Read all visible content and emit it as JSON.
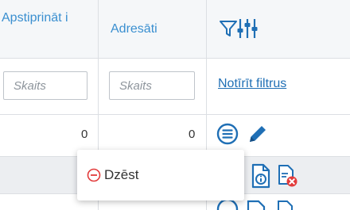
{
  "columns": {
    "apstiprinati_title": "Apstiprināt i",
    "adresati_title": "Adresāti"
  },
  "filters": {
    "apstiprinati_placeholder": "Skaits",
    "adresati_placeholder": "Skaits",
    "clear_label": "Notīrīt filtrus"
  },
  "row1": {
    "apstiprinati_value": "0",
    "adresati_value": "0"
  },
  "context_menu": {
    "delete_label": "Dzēst"
  },
  "colors": {
    "link": "#1f6fb5",
    "header_text": "#3a8fd0",
    "delete_red": "#e23b3b"
  }
}
